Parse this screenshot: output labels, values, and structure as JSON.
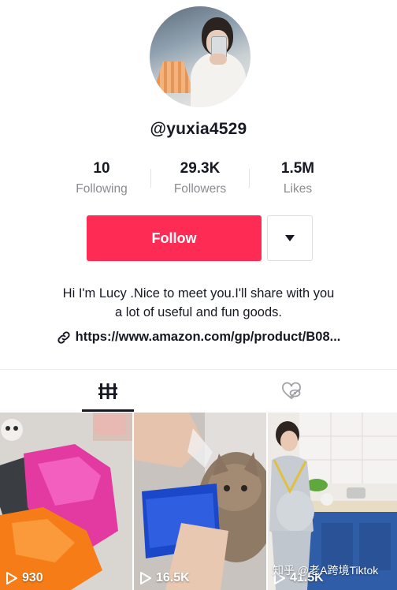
{
  "profile": {
    "username": "@yuxia4529",
    "bio_line1": "Hi I'm Lucy .Nice to meet you.I'll share with you",
    "bio_line2": "a lot of useful and fun goods.",
    "link": "https://www.amazon.com/gp/product/B08..."
  },
  "stats": [
    {
      "value": "10",
      "label": "Following"
    },
    {
      "value": "29.3K",
      "label": "Followers"
    },
    {
      "value": "1.5M",
      "label": "Likes"
    }
  ],
  "actions": {
    "follow_label": "Follow",
    "more_icon": "caret-down-icon"
  },
  "tabs": [
    {
      "icon": "videos-grid-icon",
      "active": true
    },
    {
      "icon": "liked-videos-hidden-icon",
      "active": false
    }
  ],
  "videos": [
    {
      "views": "930",
      "theme": "toy cars"
    },
    {
      "views": "16.5K",
      "theme": "kitten with brush"
    },
    {
      "views": "41.5K",
      "theme": "kitchen"
    }
  ],
  "watermark": "知乎 @老A跨境Tiktok",
  "colors": {
    "accent": "#fe2c55",
    "text": "#161823",
    "muted": "#8a8b91"
  }
}
